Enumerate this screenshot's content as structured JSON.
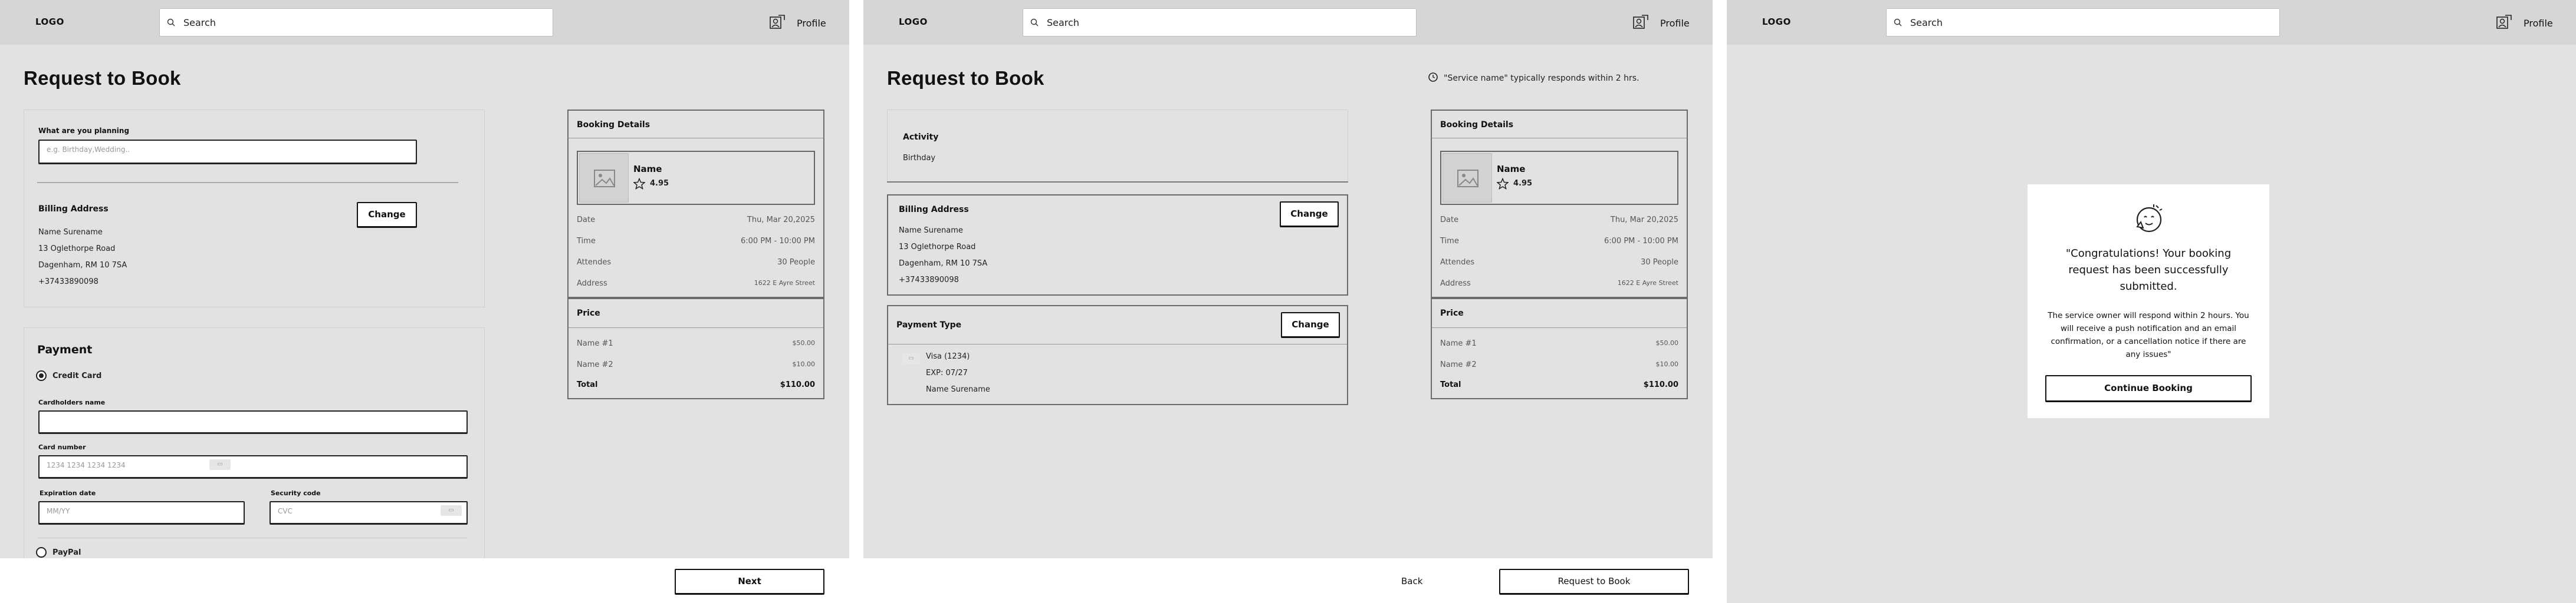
{
  "header": {
    "logo": "LOGO",
    "search_placeholder": "Search",
    "profile_label": "Profile"
  },
  "page_title": "Request to Book",
  "screen1": {
    "planning_label": "What are you planning",
    "planning_placeholder": "e.g. Birthday,Wedding..",
    "billing_title": "Billing Address",
    "change_label": "Change",
    "billing_lines": [
      "Name Surename",
      "13 Oglethorpe Road",
      "Dagenham, RM 10 7SA",
      "+37433890098"
    ],
    "payment_title": "Payment",
    "credit_card_label": "Credit Card",
    "cardholder_label": "Cardholders name",
    "card_number_label": "Card number",
    "card_number_placeholder": "1234 1234 1234 1234",
    "expiration_label": "Expiration date",
    "expiration_placeholder": "MM/YY",
    "security_label": "Security code",
    "security_placeholder": "CVC",
    "paypal_label": "PayPal",
    "next_label": "Next"
  },
  "booking": {
    "title": "Booking Details",
    "name": "Name",
    "rating": "4.95",
    "rows": [
      {
        "label": "Date",
        "value": "Thu, Mar 20,2025"
      },
      {
        "label": "Time",
        "value": "6:00 PM - 10:00 PM"
      },
      {
        "label": "Attendes",
        "value": "30 People"
      },
      {
        "label": "Address",
        "value": "1622 E Ayre Street"
      }
    ],
    "price_title": "Price",
    "price_rows": [
      {
        "label": "Name #1",
        "value": "$50.00"
      },
      {
        "label": "Name #2",
        "value": "$10.00"
      }
    ],
    "total_label": "Total",
    "total_value": "$110.00"
  },
  "screen2": {
    "notice": "\"Service name\" typically responds within 2 hrs.",
    "activity_title": "Activity",
    "activity_value": "Birthday",
    "billing_title": "Billing Address",
    "change_label": "Change",
    "billing_lines": [
      "Name Surename",
      "13 Oglethorpe Road",
      "Dagenham, RM 10 7SA",
      "+37433890098"
    ],
    "payment_type_title": "Payment Type",
    "payment_change_label": "Change",
    "card_lines": [
      "Visa (1234)",
      "EXP: 07/27",
      "Name Surename"
    ],
    "back_label": "Back",
    "request_label": "Request to Book"
  },
  "screen3": {
    "modal_title": "\"Congratulations! Your booking request has been successfully submitted.",
    "modal_body": "The service owner will respond within 2 hours. You will receive a push notification and an email confirmation, or a cancellation notice if there are any issues\"",
    "continue_label": "Continue Booking"
  }
}
